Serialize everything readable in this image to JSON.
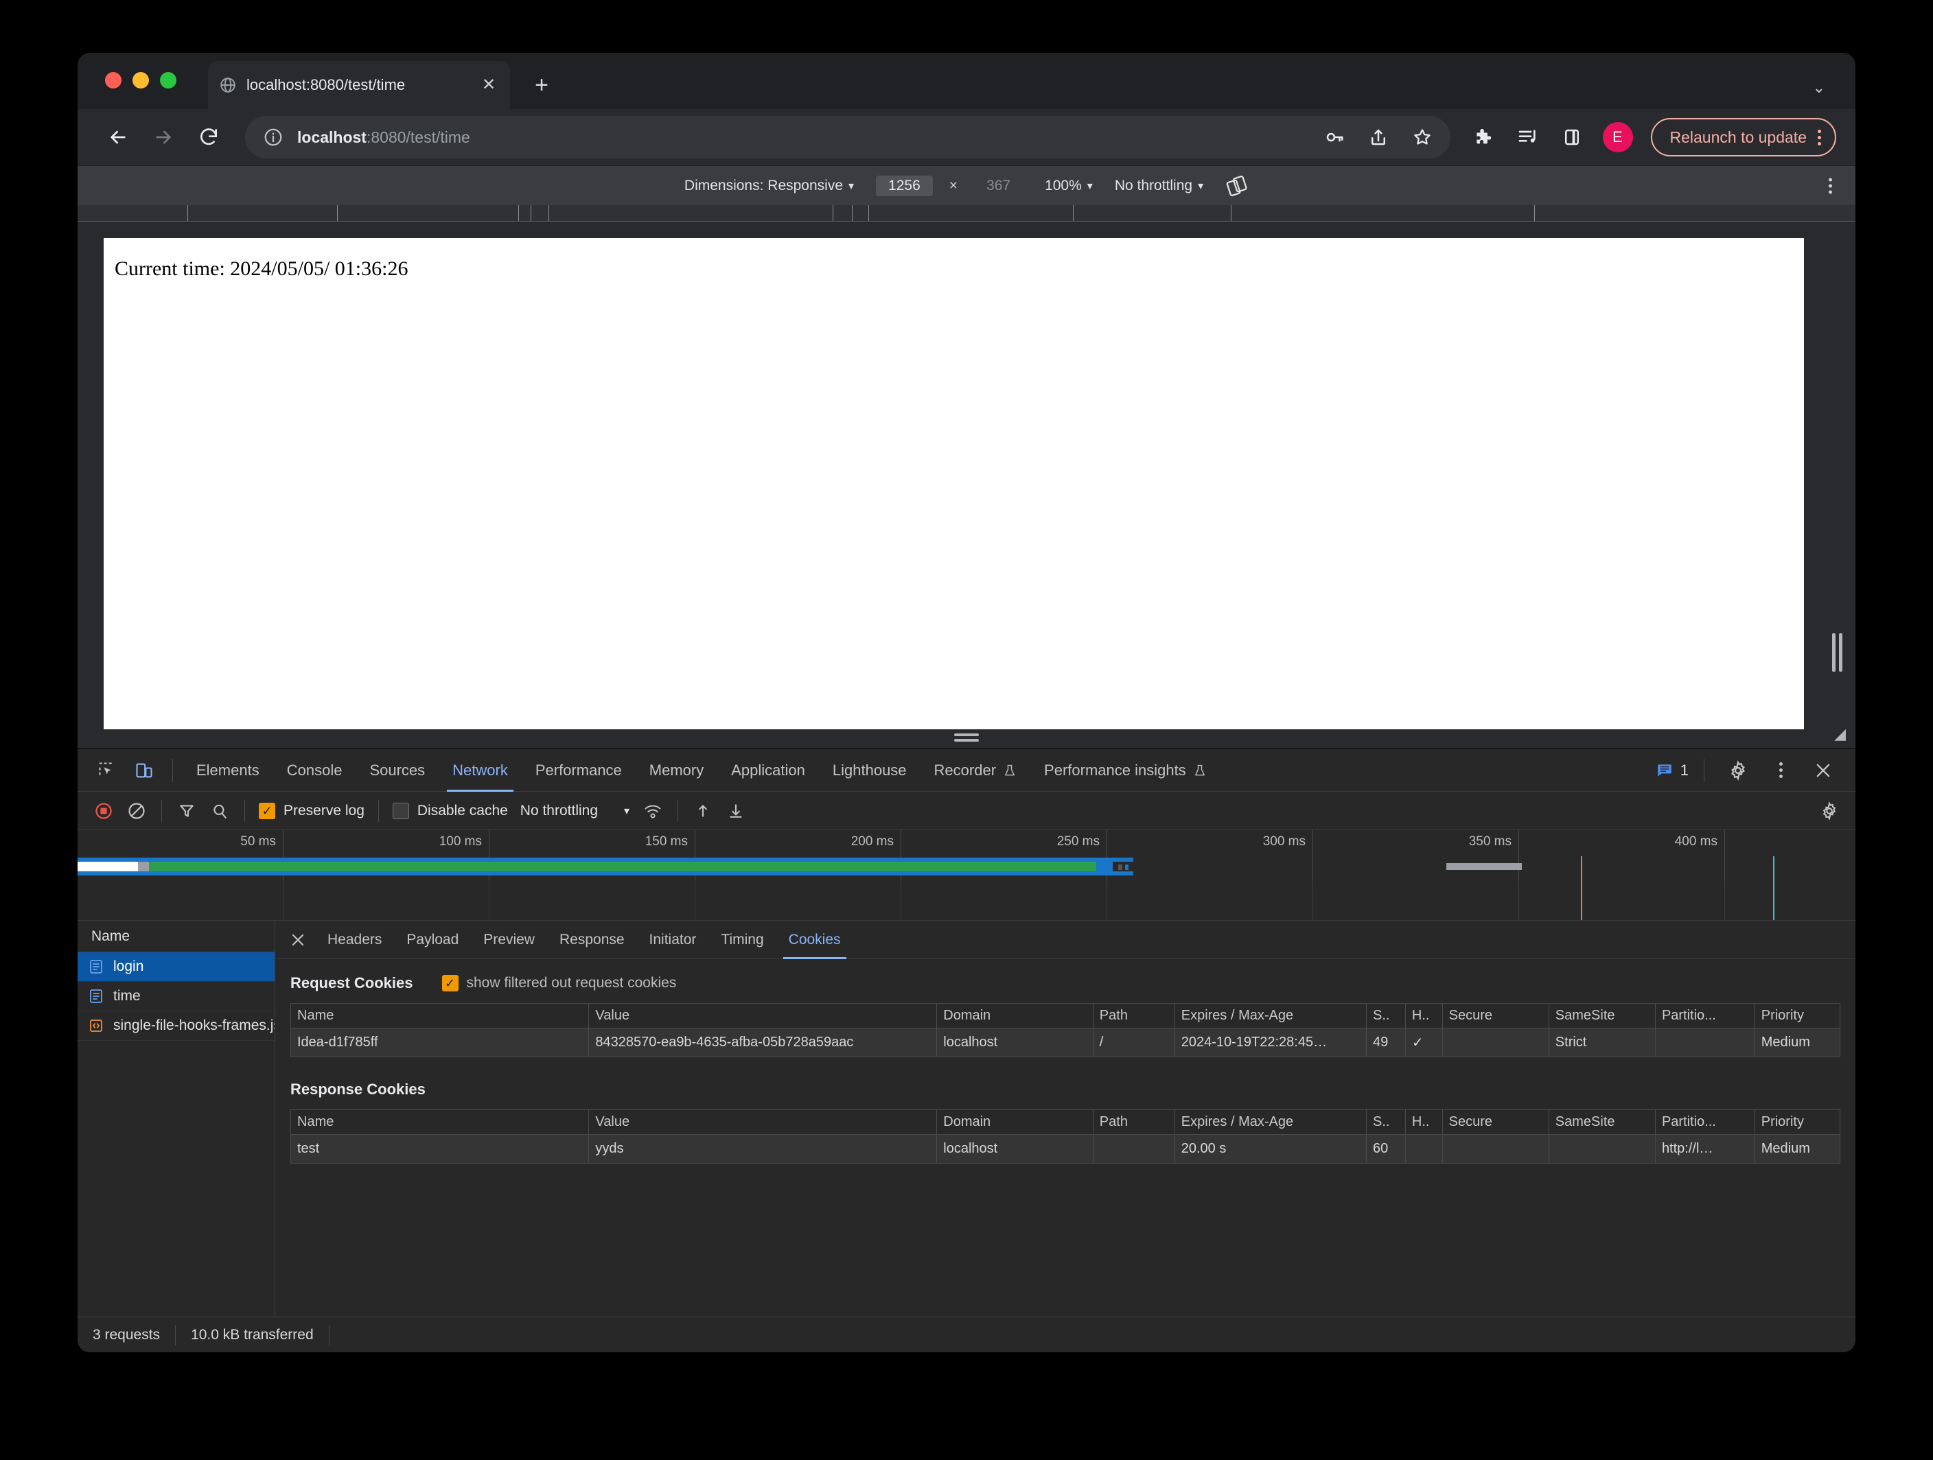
{
  "browser": {
    "tab": {
      "title": "localhost:8080/test/time",
      "favicon": "globe-icon",
      "close": "✕"
    },
    "new_tab": "+",
    "tabstrip_caret": "⌄",
    "omnibox": {
      "host": "localhost",
      "rest": ":8080/test/time",
      "info_icon": "info-circle-icon"
    },
    "profile_initial": "E",
    "relaunch_label": "Relaunch to update"
  },
  "device_toolbar": {
    "dimensions_label": "Dimensions: Responsive",
    "width": "1256",
    "times": "×",
    "height": "367",
    "zoom": "100%",
    "throttling": "No throttling",
    "caret": "▾"
  },
  "page": {
    "content": "Current time: 2024/05/05/ 01:36:26"
  },
  "devtools": {
    "tabs": [
      {
        "label": "Elements",
        "active": false
      },
      {
        "label": "Console",
        "active": false
      },
      {
        "label": "Sources",
        "active": false
      },
      {
        "label": "Network",
        "active": true
      },
      {
        "label": "Performance",
        "active": false
      },
      {
        "label": "Memory",
        "active": false
      },
      {
        "label": "Application",
        "active": false
      },
      {
        "label": "Lighthouse",
        "active": false
      },
      {
        "label": "Recorder",
        "active": false,
        "beaker": true
      },
      {
        "label": "Performance insights",
        "active": false,
        "beaker": true
      }
    ],
    "message_count": "1",
    "network_toolbar": {
      "preserve_log": "Preserve log",
      "preserve_log_checked": true,
      "disable_cache": "Disable cache",
      "disable_cache_checked": false,
      "throttling": "No throttling",
      "caret": "▾"
    },
    "overview": {
      "ticks": [
        "50 ms",
        "100 ms",
        "150 ms",
        "200 ms",
        "250 ms",
        "300 ms",
        "350 ms",
        "400 ms"
      ]
    },
    "requests": {
      "column_header": "Name",
      "rows": [
        {
          "name": "login",
          "icon": "document-icon",
          "selected": true
        },
        {
          "name": "time",
          "icon": "document-icon",
          "selected": false
        },
        {
          "name": "single-file-hooks-frames.js",
          "icon": "script-icon",
          "selected": false
        }
      ]
    },
    "detail_tabs": [
      {
        "label": "Headers",
        "active": false
      },
      {
        "label": "Payload",
        "active": false
      },
      {
        "label": "Preview",
        "active": false
      },
      {
        "label": "Response",
        "active": false
      },
      {
        "label": "Initiator",
        "active": false
      },
      {
        "label": "Timing",
        "active": false
      },
      {
        "label": "Cookies",
        "active": true
      }
    ],
    "cookies": {
      "request_title": "Request Cookies",
      "filter_label": "show filtered out request cookies",
      "filter_checked": true,
      "response_title": "Response Cookies",
      "columns": [
        "Name",
        "Value",
        "Domain",
        "Path",
        "Expires / Max-Age",
        "S..",
        "H..",
        "Secure",
        "SameSite",
        "Partitio...",
        "Priority"
      ],
      "request_rows": [
        {
          "name": "Idea-d1f785ff",
          "value": "84328570-ea9b-4635-afba-05b728a59aac",
          "domain": "localhost",
          "path": "/",
          "expires": "2024-10-19T22:28:45…",
          "size": "49",
          "httponly": "✓",
          "secure": "",
          "samesite": "Strict",
          "partition": "",
          "priority": "Medium"
        }
      ],
      "response_rows": [
        {
          "name": "test",
          "value": "yyds",
          "domain": "localhost",
          "path": "",
          "expires": "20.00 s",
          "size": "60",
          "httponly": "",
          "secure": "",
          "samesite": "",
          "partition": "http://l…",
          "priority": "Medium"
        }
      ]
    },
    "status": {
      "requests": "3 requests",
      "transferred": "10.0 kB transferred"
    }
  },
  "colors": {
    "accent_blue": "#8ab4f8",
    "selection_blue": "#0b57a4",
    "checkbox_orange": "#f29900",
    "relaunch_pink": "#f6aea9",
    "avatar_pink": "#e8115b",
    "bar_green": "#2e9e4f",
    "bar_blue": "#1976c8",
    "marker_red": "#e8795a",
    "marker_cyan": "#49c0c0"
  }
}
